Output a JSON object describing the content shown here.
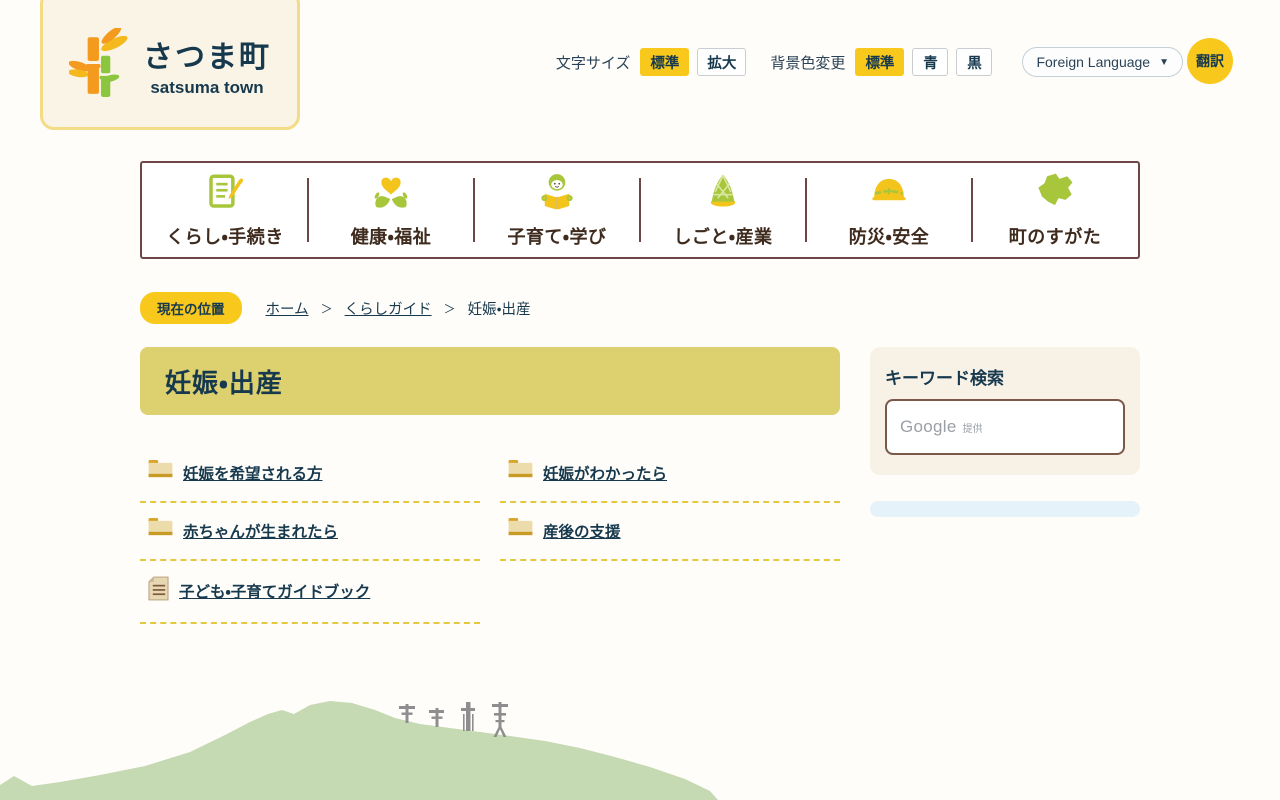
{
  "site": {
    "name": "さつま町",
    "name_en": "satsuma town"
  },
  "toolbar": {
    "font_size_label": "文字サイズ",
    "font_size_standard": "標準",
    "font_size_large": "拡大",
    "bg_color_label": "背景色変更",
    "bg_standard": "標準",
    "bg_blue": "青",
    "bg_black": "黒",
    "language_selector": "Foreign Language",
    "language_caret": "▼",
    "translate_label": "翻訳"
  },
  "nav": {
    "items": [
      {
        "label": "くらし・手続き",
        "icon": "document-pen-icon"
      },
      {
        "label": "健康・福祉",
        "icon": "hands-heart-icon"
      },
      {
        "label": "子育て・学び",
        "icon": "child-reading-icon"
      },
      {
        "label": "しごと・産業",
        "icon": "bamboo-shoot-icon"
      },
      {
        "label": "防災・安全",
        "icon": "helmet-icon"
      },
      {
        "label": "町のすがた",
        "icon": "town-map-icon"
      }
    ]
  },
  "breadcrumb": {
    "badge": "現在の位置",
    "separator": "＞",
    "items": [
      {
        "label": "ホーム"
      },
      {
        "label": "くらしガイド"
      },
      {
        "label": "妊娠・出産"
      }
    ]
  },
  "page": {
    "title": "妊娠・出産"
  },
  "links": [
    {
      "label": "妊娠を希望される方",
      "icon": "folder-icon"
    },
    {
      "label": "妊娠がわかったら",
      "icon": "folder-icon"
    },
    {
      "label": "赤ちゃんが生まれたら",
      "icon": "folder-icon"
    },
    {
      "label": "産後の支援",
      "icon": "folder-icon"
    },
    {
      "label": "子ども・子育てガイドブック",
      "icon": "document-icon"
    }
  ],
  "sidebar": {
    "search_title": "キーワード検索",
    "search_brand": "Google",
    "search_brand_suffix": "提供"
  },
  "colors": {
    "accent_yellow": "#f8c81c",
    "title_banner_yellow": "#ddd06e",
    "nav_border_maroon": "#6d4747",
    "nav_text_brown": "#3e2b1e",
    "text_navy": "#17394e",
    "hill_green": "#c5d9b3",
    "sidebar_beige": "#f8f1e6",
    "blue_bar": "#e6f2f9",
    "icon_green": "#a8c63c",
    "icon_yellow": "#f3c41c",
    "logo_orange": "#f49b1f",
    "logo_green": "#8cc63f"
  }
}
